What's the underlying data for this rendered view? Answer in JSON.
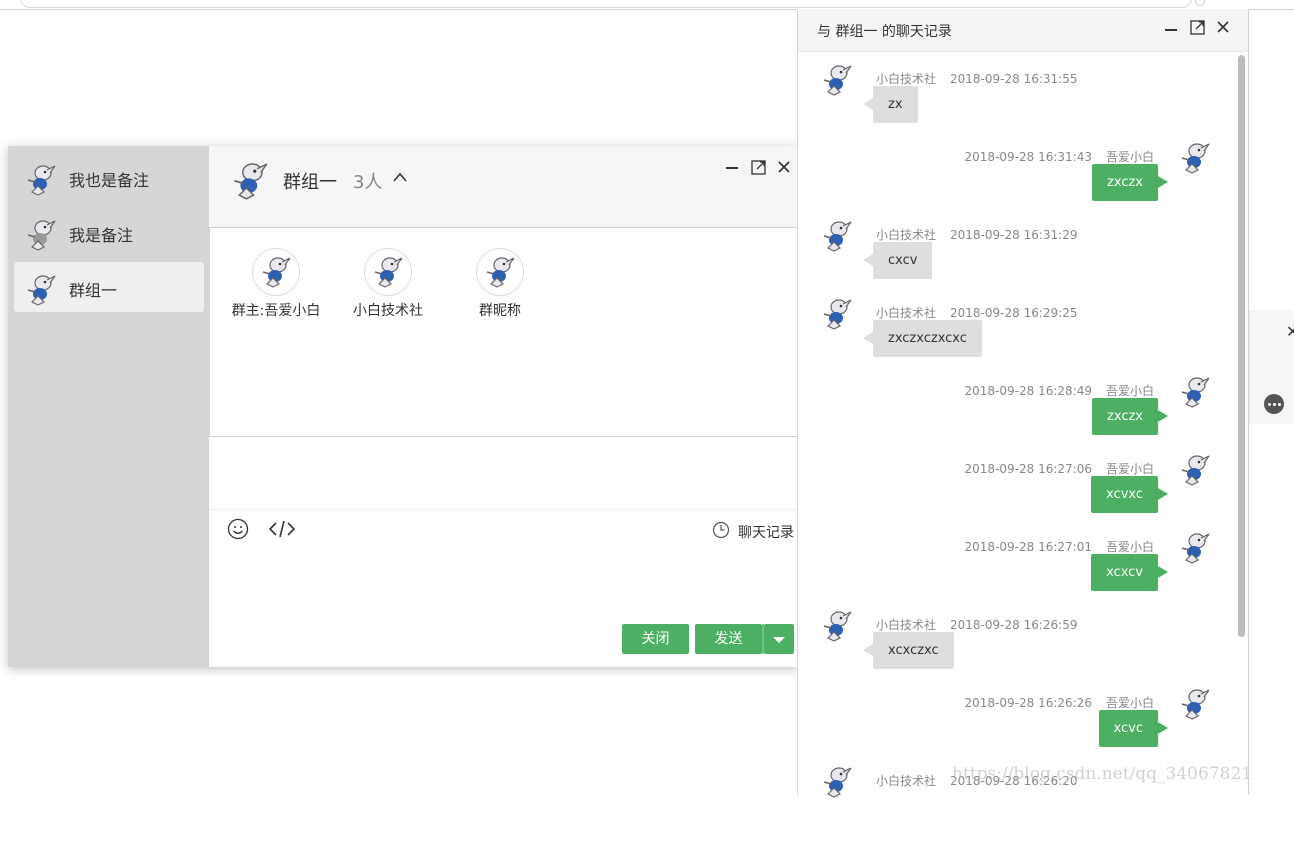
{
  "chat_window": {
    "sidebar": {
      "items": [
        {
          "label": "我也是备注"
        },
        {
          "label": "我是备注"
        },
        {
          "label": "群组一",
          "active": true
        }
      ]
    },
    "header": {
      "title": "群组一",
      "member_count": "3人"
    },
    "members": [
      {
        "name": "群主:吾爱小白"
      },
      {
        "name": "小白技术社"
      },
      {
        "name": "群昵称"
      }
    ],
    "toolbar": {
      "history_label": "聊天记录"
    },
    "buttons": {
      "close_label": "关闭",
      "send_label": "发送"
    }
  },
  "history_window": {
    "title": "与 群组一 的聊天记录",
    "messages": [
      {
        "side": "left",
        "sender": "小白技术社",
        "time": "2018-09-28 16:31:55",
        "text": "zx"
      },
      {
        "side": "right",
        "sender": "吾爱小白",
        "time": "2018-09-28 16:31:43",
        "text": "zxczx"
      },
      {
        "side": "left",
        "sender": "小白技术社",
        "time": "2018-09-28 16:31:29",
        "text": "cxcv"
      },
      {
        "side": "left",
        "sender": "小白技术社",
        "time": "2018-09-28 16:29:25",
        "text": "zxczxczxcxc"
      },
      {
        "side": "right",
        "sender": "吾爱小白",
        "time": "2018-09-28 16:28:49",
        "text": "zxczx"
      },
      {
        "side": "right",
        "sender": "吾爱小白",
        "time": "2018-09-28 16:27:06",
        "text": "xcvxc"
      },
      {
        "side": "right",
        "sender": "吾爱小白",
        "time": "2018-09-28 16:27:01",
        "text": "xcxcv"
      },
      {
        "side": "left",
        "sender": "小白技术社",
        "time": "2018-09-28 16:26:59",
        "text": "xcxczxc"
      },
      {
        "side": "right",
        "sender": "吾爱小白",
        "time": "2018-09-28 16:26:26",
        "text": "xcvc"
      },
      {
        "side": "left",
        "sender": "小白技术社",
        "time": "2018-09-28 16:26:20",
        "text": ""
      }
    ]
  },
  "watermark": "https://blog.csdn.net/qq_34067821",
  "colors": {
    "accent_green": "#4caf64",
    "sidebar_bg": "#d6d6d6",
    "bubble_gray": "#dedede"
  },
  "icons": [
    "mascot-avatar-icon",
    "minimize-icon",
    "maximize-icon",
    "close-icon",
    "chevron-up-icon",
    "emoji-icon",
    "code-icon",
    "clock-icon",
    "chat-bubble-icon",
    "caret-down-icon"
  ]
}
